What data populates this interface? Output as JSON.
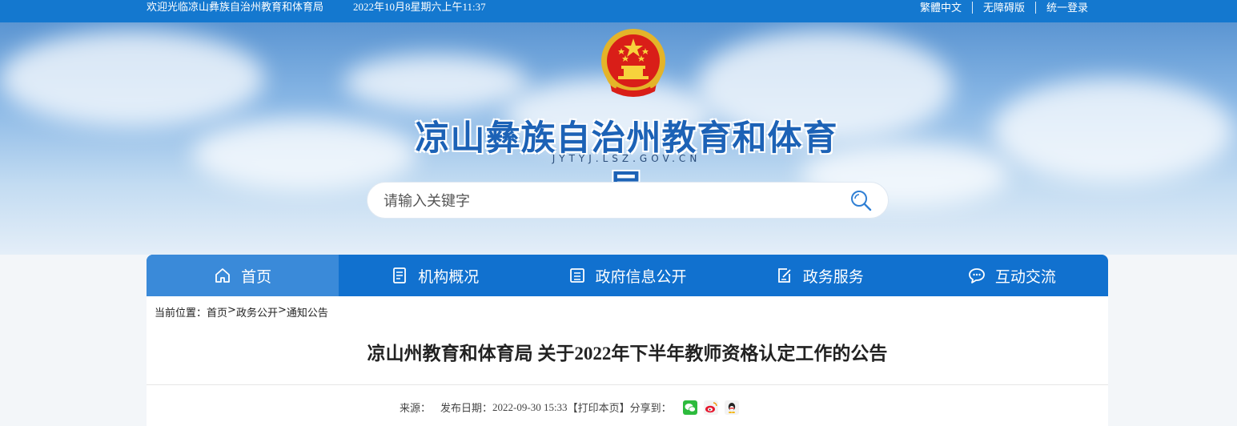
{
  "topbar": {
    "welcome": "欢迎光临凉山彝族自治州教育和体育局",
    "datetime": "2022年10月8星期六上午11:37",
    "links": [
      "繁體中文",
      "无障碍版",
      "统一登录"
    ]
  },
  "header": {
    "title": "凉山彝族自治州教育和体育局",
    "domain": "JYTYJ.LSZ.GOV.CN"
  },
  "search": {
    "placeholder": "请输入关键字"
  },
  "nav": {
    "items": [
      {
        "label": "首页",
        "icon": "home-icon"
      },
      {
        "label": "机构概况",
        "icon": "document-list-icon"
      },
      {
        "label": "政府信息公开",
        "icon": "document-icon"
      },
      {
        "label": "政务服务",
        "icon": "edit-document-icon"
      },
      {
        "label": "互动交流",
        "icon": "chat-icon"
      }
    ]
  },
  "breadcrumb": {
    "label": "当前位置：",
    "items": [
      "首页",
      "政务公开",
      "通知公告"
    ],
    "separator": ">"
  },
  "article": {
    "title": "凉山州教育和体育局 关于2022年下半年教师资格认定工作的公告",
    "source_label": "来源：",
    "date_label": "发布日期：",
    "date": "2022-09-30 15:33",
    "print_label": "【打印本页】",
    "share_label": "分享到："
  },
  "colors": {
    "primary": "#1171cf",
    "topbar": "#1478cf",
    "nav_active": "#3a8ad9",
    "title_blue": "#1c62b6"
  }
}
